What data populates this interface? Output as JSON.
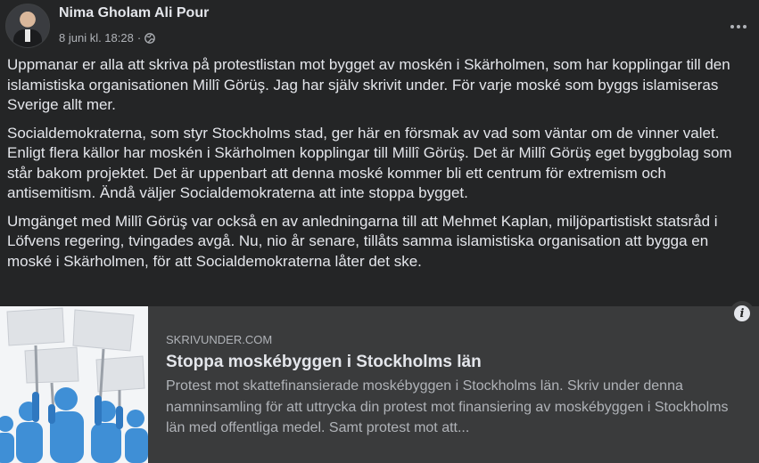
{
  "post": {
    "author": "Nima Gholam Ali Pour",
    "date": "8 juni kl. 18:28",
    "separator": "·",
    "privacy_icon": "globe-icon",
    "more_icon": "more-horizontal-icon",
    "paragraphs": [
      "Uppmanar er alla att skriva på protestlistan mot bygget av moskén i Skärholmen, som har kopplingar till den islamistiska organisationen Millî Görüş. Jag har själv skrivit under. För varje moské som byggs islamiseras Sverige allt mer.",
      "Socialdemokraterna, som styr Stockholms stad, ger här en försmak av vad som väntar om de vinner valet. Enligt flera källor har moskén i Skärholmen kopplingar till Millî Görüş. Det är Millî Görüş eget byggbolag som står bakom projektet. Det är uppenbart att denna moské kommer bli ett centrum för extremism och antisemitism. Ändå väljer Socialdemokraterna att inte stoppa bygget.",
      "Umgänget med Millî Görüş var också en av anledningarna till att Mehmet Kaplan, miljöpartistiskt statsråd i Löfvens regering, tvingades avgå. Nu, nio år senare, tillåts samma islamistiska organisation att bygga en moské i Skärholmen, för att Socialdemokraterna låter det ske."
    ]
  },
  "link_preview": {
    "domain": "SKRIVUNDER.COM",
    "title": "Stoppa moskébyggen i Stockholms län",
    "description": "Protest mot skattefinansierade moskébyggen i Stockholms län. Skriv under denna namninsamling för att uttrycka din protest mot finansiering av moskébyggen i Stockholms län med offentliga medel. Samt protest mot att...",
    "info_label": "i",
    "thumbnail_icon": "protest-crowd-image"
  }
}
